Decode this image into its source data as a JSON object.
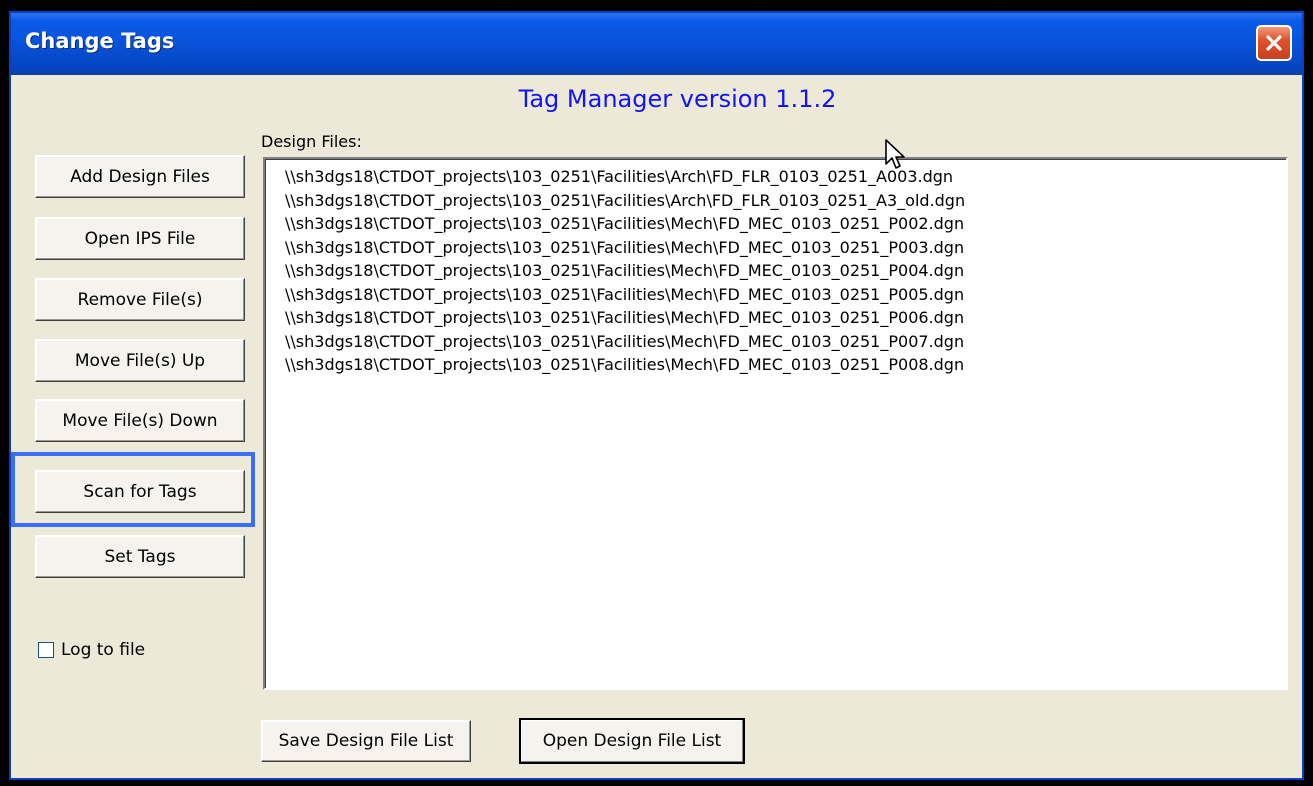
{
  "window": {
    "title": "Change Tags"
  },
  "header": {
    "title": "Tag Manager version 1.1.2"
  },
  "sidebar": {
    "buttons": [
      {
        "label": "Add Design Files"
      },
      {
        "label": "Open IPS File"
      },
      {
        "label": "Remove File(s)"
      },
      {
        "label": "Move File(s) Up"
      },
      {
        "label": "Move File(s) Down"
      },
      {
        "label": "Scan for Tags"
      },
      {
        "label": "Set Tags"
      }
    ],
    "log_checkbox": {
      "label": "Log to file",
      "checked": false
    }
  },
  "design_files": {
    "label": "Design Files:",
    "items": [
      "\\\\sh3dgs18\\CTDOT_projects\\103_0251\\Facilities\\Arch\\FD_FLR_0103_0251_A003.dgn",
      "\\\\sh3dgs18\\CTDOT_projects\\103_0251\\Facilities\\Arch\\FD_FLR_0103_0251_A3_old.dgn",
      "\\\\sh3dgs18\\CTDOT_projects\\103_0251\\Facilities\\Mech\\FD_MEC_0103_0251_P002.dgn",
      "\\\\sh3dgs18\\CTDOT_projects\\103_0251\\Facilities\\Mech\\FD_MEC_0103_0251_P003.dgn",
      "\\\\sh3dgs18\\CTDOT_projects\\103_0251\\Facilities\\Mech\\FD_MEC_0103_0251_P004.dgn",
      "\\\\sh3dgs18\\CTDOT_projects\\103_0251\\Facilities\\Mech\\FD_MEC_0103_0251_P005.dgn",
      "\\\\sh3dgs18\\CTDOT_projects\\103_0251\\Facilities\\Mech\\FD_MEC_0103_0251_P006.dgn",
      "\\\\sh3dgs18\\CTDOT_projects\\103_0251\\Facilities\\Mech\\FD_MEC_0103_0251_P007.dgn",
      "\\\\sh3dgs18\\CTDOT_projects\\103_0251\\Facilities\\Mech\\FD_MEC_0103_0251_P008.dgn"
    ]
  },
  "footer": {
    "save_label": "Save Design File List",
    "open_label": "Open Design File List"
  },
  "colors": {
    "header_text": "#1414F0",
    "highlight": "#3A6EF4",
    "titlebar": "#0852D9"
  },
  "icons": {
    "close": "close-icon",
    "cursor": "mouse-pointer-icon"
  }
}
